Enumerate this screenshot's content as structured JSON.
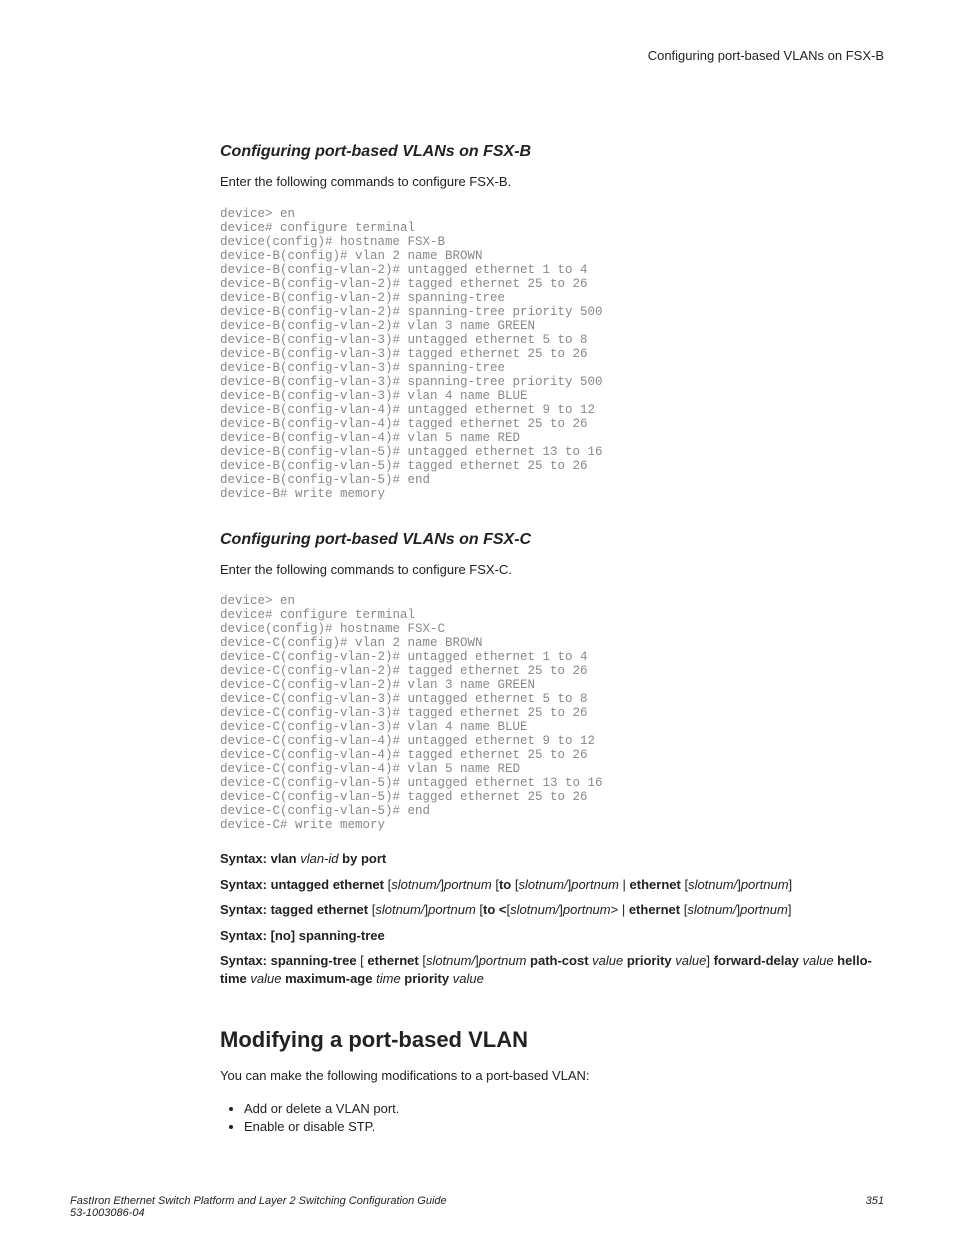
{
  "runningHeader": "Configuring port-based VLANs on FSX-B",
  "section1": {
    "title": "Configuring port-based VLANs on FSX-B",
    "intro": "Enter the following commands to configure FSX-B.",
    "code": "device> en\ndevice# configure terminal\ndevice(config)# hostname FSX-B\ndevice-B(config)# vlan 2 name BROWN\ndevice-B(config-vlan-2)# untagged ethernet 1 to 4\ndevice-B(config-vlan-2)# tagged ethernet 25 to 26\ndevice-B(config-vlan-2)# spanning-tree\ndevice-B(config-vlan-2)# spanning-tree priority 500\ndevice-B(config-vlan-2)# vlan 3 name GREEN\ndevice-B(config-vlan-3)# untagged ethernet 5 to 8\ndevice-B(config-vlan-3)# tagged ethernet 25 to 26\ndevice-B(config-vlan-3)# spanning-tree\ndevice-B(config-vlan-3)# spanning-tree priority 500\ndevice-B(config-vlan-3)# vlan 4 name BLUE\ndevice-B(config-vlan-4)# untagged ethernet 9 to 12\ndevice-B(config-vlan-4)# tagged ethernet 25 to 26\ndevice-B(config-vlan-4)# vlan 5 name RED\ndevice-B(config-vlan-5)# untagged ethernet 13 to 16\ndevice-B(config-vlan-5)# tagged ethernet 25 to 26\ndevice-B(config-vlan-5)# end\ndevice-B# write memory"
  },
  "section2": {
    "title": "Configuring port-based VLANs on FSX-C",
    "intro": "Enter the following commands to configure FSX-C.",
    "code": "device> en\ndevice# configure terminal\ndevice(config)# hostname FSX-C\ndevice-C(config)# vlan 2 name BROWN\ndevice-C(config-vlan-2)# untagged ethernet 1 to 4\ndevice-C(config-vlan-2)# tagged ethernet 25 to 26\ndevice-C(config-vlan-2)# vlan 3 name GREEN\ndevice-C(config-vlan-3)# untagged ethernet 5 to 8\ndevice-C(config-vlan-3)# tagged ethernet 25 to 26\ndevice-C(config-vlan-3)# vlan 4 name BLUE\ndevice-C(config-vlan-4)# untagged ethernet 9 to 12\ndevice-C(config-vlan-4)# tagged ethernet 25 to 26\ndevice-C(config-vlan-4)# vlan 5 name RED\ndevice-C(config-vlan-5)# untagged ethernet 13 to 16\ndevice-C(config-vlan-5)# tagged ethernet 25 to 26\ndevice-C(config-vlan-5)# end\ndevice-C# write memory"
  },
  "syntax": {
    "s1": {
      "label": "Syntax:",
      "kw1": "vlan",
      "arg1": "vlan-id",
      "kw2": "by port"
    },
    "s2": {
      "label": "Syntax:",
      "kw1": "untagged ethernet",
      "arg1": "slotnum/",
      "arg2": "portnum",
      "kw2": "to",
      "arg3": "slotnum/",
      "arg4": "portnum",
      "kw3": "ethernet",
      "arg5": "slotnum/",
      "arg6": "portnum"
    },
    "s3": {
      "label": "Syntax:",
      "kw1": "tagged ethernet",
      "arg1": "slotnum/",
      "arg2": "portnum",
      "kw2": "to <",
      "arg3": "slotnum/",
      "arg4": "portnum",
      "kw3": "ethernet",
      "arg5": "slotnum/",
      "arg6": "portnum"
    },
    "s4": {
      "label": "Syntax:",
      "kw1": "[no]",
      "kw2": "spanning-tree"
    },
    "s5": {
      "label": "Syntax:",
      "kw1": "spanning-tree",
      "kw2": "ethernet",
      "arg1": "slotnum/",
      "arg2": "portnum",
      "kw3": "path-cost",
      "arg3": "value",
      "kw4": "priority",
      "arg4": "value",
      "kw5": "forward-delay",
      "arg5": "value",
      "kw6": "hello-time",
      "arg6": "value",
      "kw7": "maximum-age",
      "arg7": "time",
      "kw8": "priority",
      "arg8": "value"
    }
  },
  "section3": {
    "title": "Modifying a port-based VLAN",
    "intro": "You can make the following modifications to a port-based VLAN:",
    "bullets": [
      "Add or delete a VLAN port.",
      "Enable or disable STP."
    ]
  },
  "footer": {
    "leftLine1": "FastIron Ethernet Switch Platform and Layer 2 Switching Configuration Guide",
    "leftLine2": "53-1003086-04",
    "right": "351"
  }
}
